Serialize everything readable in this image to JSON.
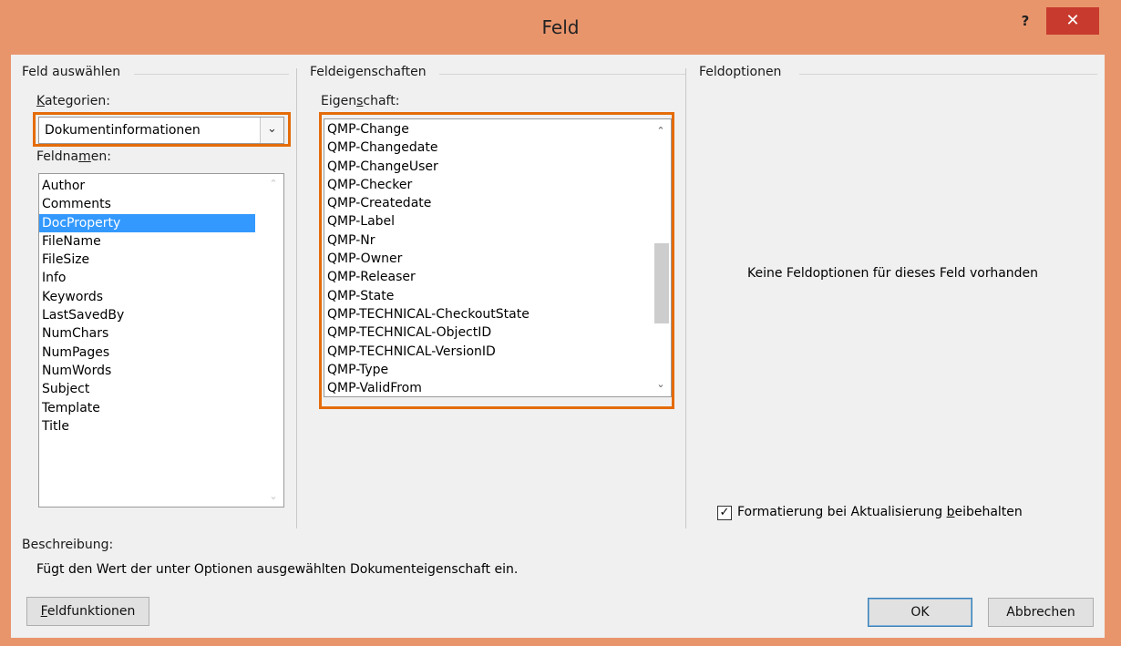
{
  "window": {
    "title": "Feld",
    "help_label": "?",
    "close_label": "✕"
  },
  "field_select": {
    "group_title": "Feld auswählen",
    "categories_label_pre": "",
    "categories_label_underline": "K",
    "categories_label_post": "ategorien:",
    "category_value": "Dokumentinformationen",
    "fieldnames_label_pre": "Feldna",
    "fieldnames_label_underline": "m",
    "fieldnames_label_post": "en:",
    "fieldnames": [
      "Author",
      "Comments",
      "DocProperty",
      "FileName",
      "FileSize",
      "Info",
      "Keywords",
      "LastSavedBy",
      "NumChars",
      "NumPages",
      "NumWords",
      "Subject",
      "Template",
      "Title"
    ],
    "selected_fieldname": "DocProperty"
  },
  "field_properties": {
    "group_title": "Feldeigenschaften",
    "property_label_pre": "Eigen",
    "property_label_underline": "s",
    "property_label_post": "chaft:",
    "properties": [
      "QMP-Change",
      "QMP-Changedate",
      "QMP-ChangeUser",
      "QMP-Checker",
      "QMP-Createdate",
      "QMP-Label",
      "QMP-Nr",
      "QMP-Owner",
      "QMP-Releaser",
      "QMP-State",
      "QMP-TECHNICAL-CheckoutState",
      "QMP-TECHNICAL-ObjectID",
      "QMP-TECHNICAL-VersionID",
      "QMP-Type",
      "QMP-ValidFrom"
    ]
  },
  "field_options": {
    "group_title": "Feldoptionen",
    "message": "Keine Feldoptionen für dieses Feld vorhanden",
    "preserve_formatting_pre": "Formatierung bei Aktualisierung ",
    "preserve_formatting_underline": "b",
    "preserve_formatting_post": "eibehalten",
    "preserve_formatting_checked": true
  },
  "description": {
    "label": "Beschreibung:",
    "text": "Fügt den Wert der unter Optionen ausgewählten Dokumenteigenschaft ein."
  },
  "buttons": {
    "field_codes_underline": "F",
    "field_codes_post": "eldfunktionen",
    "ok": "OK",
    "cancel": "Abbrechen"
  },
  "colors": {
    "frame": "#e9956c",
    "close": "#c83a2e",
    "highlight": "#e46c0a",
    "selection": "#3399ff"
  }
}
